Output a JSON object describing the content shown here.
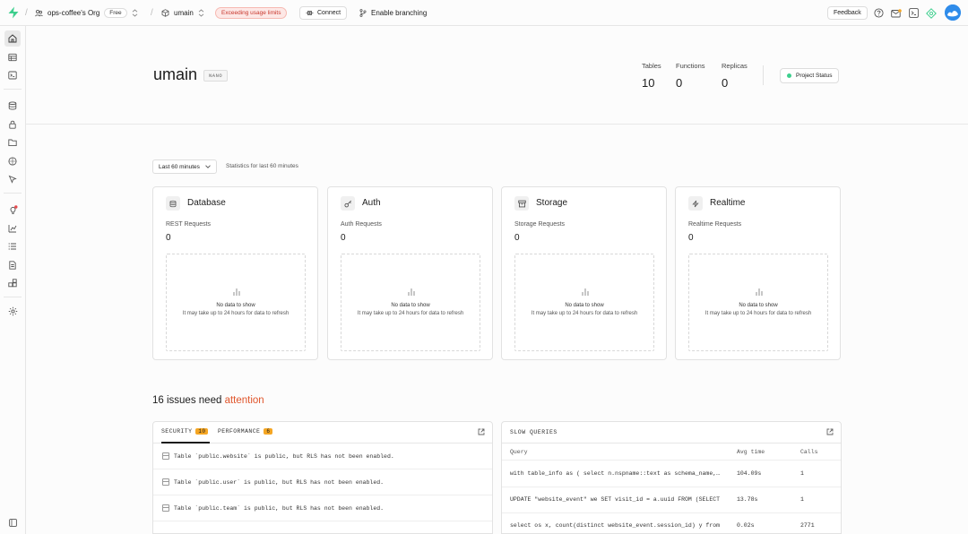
{
  "topbar": {
    "org_name": "ops-coffee's Org",
    "plan_badge": "Free",
    "project_name": "umain",
    "usage_badge": "Exceeding usage limits",
    "connect_label": "Connect",
    "branching_label": "Enable branching",
    "feedback_label": "Feedback"
  },
  "header": {
    "project_title": "umain",
    "instance_size": "NANO",
    "stats": [
      {
        "label": "Tables",
        "value": "10"
      },
      {
        "label": "Functions",
        "value": "0"
      },
      {
        "label": "Replicas",
        "value": "0"
      }
    ],
    "status_label": "Project Status"
  },
  "period": {
    "selected": "Last 60 minutes",
    "note": "Statistics for last 60 minutes"
  },
  "cards": [
    {
      "title": "Database",
      "metric": "REST Requests",
      "value": "0",
      "icon": "database-icon"
    },
    {
      "title": "Auth",
      "metric": "Auth Requests",
      "value": "0",
      "icon": "key-icon"
    },
    {
      "title": "Storage",
      "metric": "Storage Requests",
      "value": "0",
      "icon": "archive-icon"
    },
    {
      "title": "Realtime",
      "metric": "Realtime Requests",
      "value": "0",
      "icon": "bolt-icon"
    }
  ],
  "empty_state": {
    "line1": "No data to show",
    "line2": "It may take up to 24 hours for data to refresh"
  },
  "issues": {
    "title_prefix": "16 issues need",
    "title_accent": "attention",
    "tabs": [
      {
        "label": "SECURITY",
        "count": "10"
      },
      {
        "label": "PERFORMANCE",
        "count": "6"
      }
    ],
    "rows": [
      "Table `public.website` is public, but RLS has not been enabled.",
      "Table `public.user` is public, but RLS has not been enabled.",
      "Table `public.team` is public, but RLS has not been enabled."
    ]
  },
  "slow_queries": {
    "title": "SLOW QUERIES",
    "columns": {
      "query": "Query",
      "avg": "Avg time",
      "calls": "Calls"
    },
    "rows": [
      {
        "query": "with table_info as ( select n.nspname::text as schema_name, c.relname",
        "avg": "104.09s",
        "calls": "1"
      },
      {
        "query": "UPDATE \"website_event\" we SET visit_id = a.uuid FROM (SELECT",
        "avg": "13.78s",
        "calls": "1"
      },
      {
        "query": "select os x, count(distinct website_event.session_id) y from",
        "avg": "0.02s",
        "calls": "2771"
      }
    ]
  }
}
